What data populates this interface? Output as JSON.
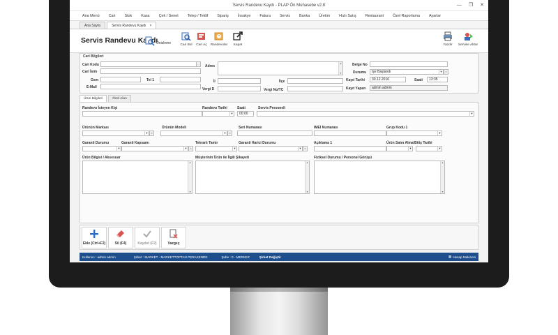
{
  "window": {
    "title": "Servis Randevu Kaydı - PLAP Ön Muhasebe v2.8"
  },
  "menu": [
    "Ana Menü",
    "Cari",
    "Stok",
    "Kasa",
    "Çek / Senet",
    "Telep / Teklif",
    "Sipariş",
    "İnsakye",
    "Fatura",
    "Servis",
    "Banka",
    "Üretim",
    "Hızlı Satış",
    "Restaurant",
    "Özel Raporlama",
    "Ayarlar"
  ],
  "doc_tabs": [
    {
      "label": "Ana Sayfa"
    },
    {
      "label": "Servis Randevu Kaydı",
      "close": "×"
    }
  ],
  "toolbar": {
    "form_title": "Servis Randevu Kaydı",
    "preview": "Önizleme",
    "cari_bul": "Cari Bul",
    "cari_ac": "Cari Aç",
    "randevular": "Randevular",
    "kapat": "Kapat",
    "yazdir": "Yazdır",
    "servise_aktar": "Servise Aktar"
  },
  "cari": {
    "group_title": "Cari Bilgileri",
    "cari_kodu": "Cari Kodu",
    "cari_isim": "Cari İsim",
    "gsm": "Gsm",
    "tel1": "Tel 1",
    "email": "E-Mail",
    "adres": "Adres",
    "il": "İl",
    "ilce": "İlçe",
    "vergi_d": "Vergi D",
    "vergi_no": "Vergi No/TC",
    "belge_no": "Belge No",
    "durumu": "Durumu",
    "durumu_value": "İşe Başlandı",
    "kayit_tarihi": "Kayıt Tarihi",
    "kayit_tarihi_value": "30.12.2016",
    "saati": "Saati",
    "saati_value": "13:35",
    "kayit_yapan": "Kayıt Yapan",
    "kayit_yapan_value": "admin admin"
  },
  "inner_tabs": [
    "Ürün Bilgileri",
    "Özel Alan"
  ],
  "urun": {
    "randevu_isteyen": "Randevu İsteyen Kişi",
    "randevu_tarihi": "Randevu Tarihi",
    "saati": "Saati",
    "saati_value": "00:00",
    "servis_personeli": "Servis Personeli",
    "urun_markasi": "Ürünün Markası",
    "urun_modeli": "Ürünün Modeli",
    "seri_numarasi": "Seri Numarası",
    "imei_numarasi": "IMEI Numarası",
    "grup_kodu": "Grup Kodu 1",
    "garanti_durumu": "Garanti Durumu",
    "garanti_kapsami": "Garanti Kapsamı",
    "tekrarli_tamir": "Tekrarlı Tamir",
    "garanti_harici": "Garanti Harici Durumu",
    "aciklama": "Açıklama 1",
    "satin_alma": "Ürün Satın Alma/Bitiş Tarihi",
    "urun_bilgisi": "Ürün Bilgisi / Aksesuar",
    "sikayet": "Müşterinin Ürün ile İlgili Şikayeti",
    "fiziksel": "Fiziksel Durumu / Personel Görüşü"
  },
  "bottom": {
    "ekle": "Ekle (Ctrl+F2)",
    "sil": "Sil (F4)",
    "kaydet": "Kaydet (F2)",
    "vazgec": "Vazgeç"
  },
  "status": {
    "kullanici": "Kullanıcı : admin admin",
    "sirket": "Şirket : MARKET - MARKETTOPTAN PERAKENDE",
    "sube": "Şube : 0 - MERKEZ",
    "degistir": "Şirket Değiştir",
    "hesap": "Hesap Makinesi"
  },
  "colors": {
    "statusbar": "#1e4e8c",
    "add": "#2b6cc4",
    "delete": "#d9534f"
  }
}
